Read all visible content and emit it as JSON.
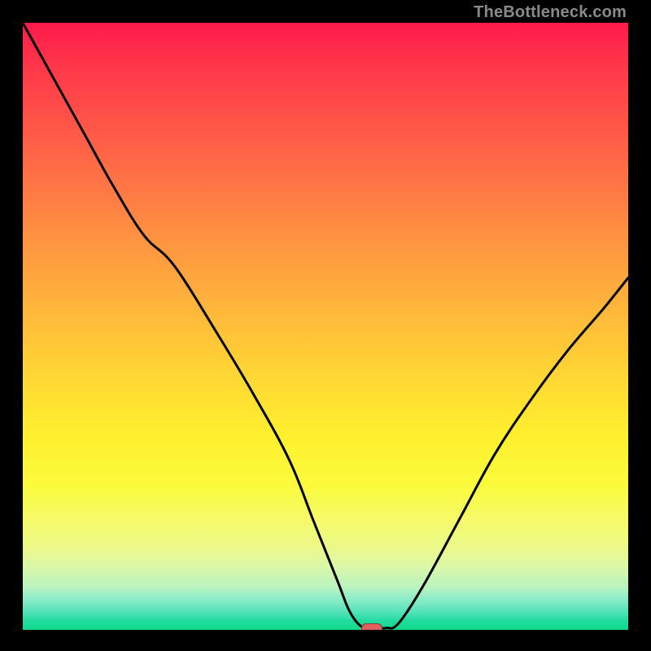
{
  "watermark": "TheBottleneck.com",
  "chart_data": {
    "type": "line",
    "title": "",
    "xlabel": "",
    "ylabel": "",
    "xlim": [
      0,
      100
    ],
    "ylim": [
      0,
      100
    ],
    "grid": false,
    "legend": false,
    "series": [
      {
        "name": "curve",
        "color": "#000000",
        "x": [
          0,
          5,
          10,
          15,
          20,
          25,
          32,
          38,
          44,
          48,
          52,
          54,
          56,
          58,
          60,
          62,
          66,
          72,
          78,
          84,
          90,
          96,
          100
        ],
        "y": [
          100,
          91,
          82,
          73,
          65,
          60,
          49,
          39,
          28,
          18,
          8,
          3,
          0.5,
          0.3,
          0.3,
          1,
          7,
          18,
          29,
          38,
          46,
          53,
          58
        ]
      }
    ],
    "marker": {
      "x": 57.5,
      "y": 0.3,
      "color": "#e0605e"
    },
    "background_gradient": {
      "top": "#ff1a4b",
      "mid": "#ffe232",
      "bottom": "#0fd989"
    }
  }
}
